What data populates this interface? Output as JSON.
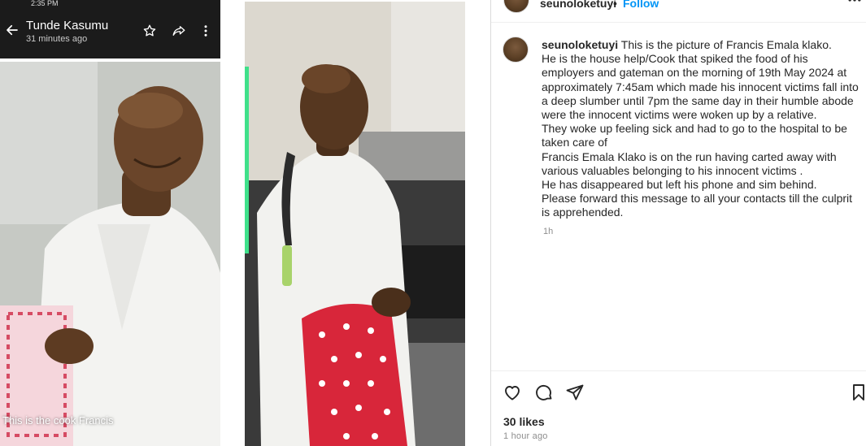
{
  "left_screenshot": {
    "status_time": "2:35 PM",
    "sender_name": "Tunde Kasumu",
    "sent_time": "31 minutes ago",
    "photo_caption": "This is the cook Francis"
  },
  "post": {
    "username": "seunoloketuyi",
    "separator": "•",
    "follow_label": "Follow",
    "caption_lines": [
      "This is the picture of Francis Emala klako.",
      "He is the house help/Cook that spiked the food of his employers and gateman on the morning of 19th May 2024 at approximately 7:45am which made his innocent victims fall into a deep slumber until 7pm the same day in their humble abode were the innocent victims were woken up by a relative.",
      "They woke up feeling sick and had to go to the hospital to be taken care of",
      "Francis Emala Klako is on the run having carted away with various valuables belonging to his innocent victims .",
      "He has disappeared but left his phone and sim behind.",
      "Please forward this message to all your contacts till the culprit is apprehended."
    ],
    "caption_time": "1h",
    "likes": "30 likes",
    "posted_ago": "1 hour ago"
  },
  "icons": {
    "back": "arrow-left-icon",
    "star": "star-icon",
    "forward": "forward-icon",
    "more_vertical": "more-vertical-icon",
    "like": "heart-icon",
    "comment": "comment-icon",
    "share": "send-icon",
    "save": "bookmark-icon",
    "more": "more-horizontal-icon"
  },
  "colors": {
    "link_blue": "#0095f6",
    "text": "#262626",
    "muted": "#8e8e8e",
    "phone_bar": "#1b1b1b"
  }
}
